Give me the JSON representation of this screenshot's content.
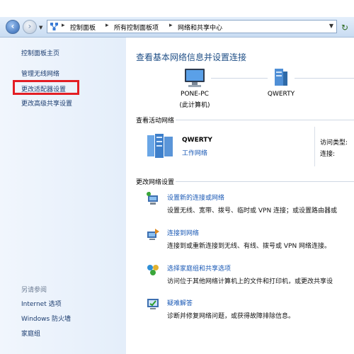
{
  "address_bar": {
    "crumbs": [
      "控制面板",
      "所有控制面板项",
      "网络和共享中心"
    ]
  },
  "sidebar": {
    "home": "控制面板主页",
    "items": [
      "管理无线网络",
      "更改适配器设置",
      "更改高级共享设置"
    ],
    "see_also_title": "另请参阅",
    "see_also": [
      "Internet 选项",
      "Windows 防火墙",
      "家庭组"
    ]
  },
  "main": {
    "title": "查看基本网络信息并设置连接",
    "map": {
      "computer_name": "PONE-PC",
      "computer_sub": "(此计算机)",
      "network_name": "QWERTY"
    },
    "active_title": "查看活动网络",
    "active": {
      "name": "QWERTY",
      "type": "工作网络",
      "access_label": "访问类型:",
      "connection_label": "连接:"
    },
    "change_title": "更改网络设置",
    "tasks": [
      {
        "link": "设置新的连接或网络",
        "desc": "设置无线、宽带、拨号、临时或 VPN 连接；或设置路由器或"
      },
      {
        "link": "连接到网络",
        "desc": "连接到或重新连接到无线、有线、拨号或 VPN 网络连接。"
      },
      {
        "link": "选择家庭组和共享选项",
        "desc": "访问位于其他网络计算机上的文件和打印机，或更改共享设"
      },
      {
        "link": "疑难解答",
        "desc": "诊断并修复网络问题，或获得故障排除信息。"
      }
    ]
  },
  "colors": {
    "link": "#1a59b5",
    "title": "#1e4e86",
    "highlight": "#e31e24"
  }
}
